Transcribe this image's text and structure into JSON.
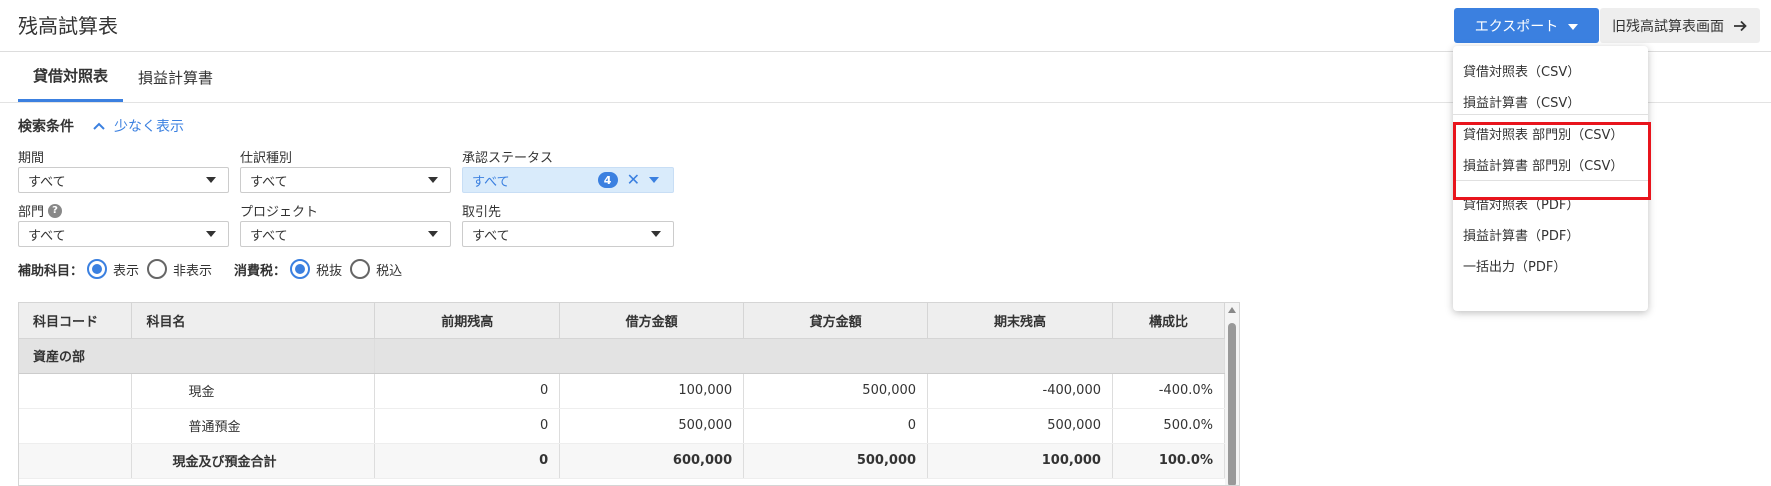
{
  "header": {
    "title": "残高試算表",
    "export_label": "エクスポート",
    "old_screen_label": "旧残高試算表画面"
  },
  "tabs": [
    {
      "label": "貸借対照表",
      "active": true
    },
    {
      "label": "損益計算書",
      "active": false
    }
  ],
  "search": {
    "title": "検索条件",
    "toggle_label": "少なく表示",
    "fields": {
      "period": {
        "label": "期間",
        "value": "すべて"
      },
      "journal_type": {
        "label": "仕訳種別",
        "value": "すべて"
      },
      "approval": {
        "label": "承認ステータス",
        "value": "すべて",
        "count": "4"
      },
      "department": {
        "label": "部門",
        "value": "すべて"
      },
      "project": {
        "label": "プロジェクト",
        "value": "すべて"
      },
      "partner": {
        "label": "取引先",
        "value": "すべて"
      }
    },
    "sub_account": {
      "label": "補助科目：",
      "options": [
        "表示",
        "非表示"
      ],
      "selected": "表示"
    },
    "tax": {
      "label": "消費税：",
      "options": [
        "税抜",
        "税込"
      ],
      "selected": "税抜"
    }
  },
  "table": {
    "columns": [
      "科目コード",
      "科目名",
      "前期残高",
      "借方金額",
      "貸方金額",
      "期末残高",
      "構成比"
    ],
    "section": "資産の部",
    "rows": [
      {
        "code": "",
        "name": "現金",
        "prev": "0",
        "debit": "100,000",
        "credit": "500,000",
        "end": "-400,000",
        "ratio": "-400.0%"
      },
      {
        "code": "",
        "name": "普通預金",
        "prev": "0",
        "debit": "500,000",
        "credit": "0",
        "end": "500,000",
        "ratio": "500.0%"
      }
    ],
    "total": {
      "name": "現金及び預金合計",
      "prev": "0",
      "debit": "600,000",
      "credit": "500,000",
      "end": "100,000",
      "ratio": "100.0%"
    }
  },
  "export_menu": {
    "items": [
      "貸借対照表（CSV）",
      "損益計算書（CSV）",
      "貸借対照表 部門別（CSV）",
      "損益計算書 部門別（CSV）",
      "貸借対照表（PDF）",
      "損益計算書（PDF）",
      "一括出力（PDF）"
    ]
  },
  "colors": {
    "accent": "#3b80e0",
    "highlight": "#e8141c"
  }
}
